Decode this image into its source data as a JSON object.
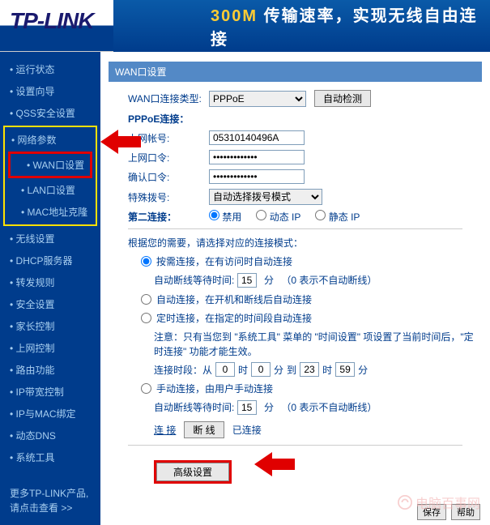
{
  "header": {
    "logo": "TP-LINK",
    "banner_prefix": "300M",
    "banner_text": " 传输速率，实现无线自由连接"
  },
  "sidebar": {
    "items": [
      {
        "label": "运行状态"
      },
      {
        "label": "设置向导"
      },
      {
        "label": "QSS安全设置"
      },
      {
        "label": "网络参数"
      },
      {
        "label": "WAN口设置",
        "sub": true,
        "current": true
      },
      {
        "label": "LAN口设置",
        "sub": true
      },
      {
        "label": "MAC地址克隆",
        "sub": true
      },
      {
        "label": "无线设置"
      },
      {
        "label": "DHCP服务器"
      },
      {
        "label": "转发规则"
      },
      {
        "label": "安全设置"
      },
      {
        "label": "家长控制"
      },
      {
        "label": "上网控制"
      },
      {
        "label": "路由功能"
      },
      {
        "label": "IP带宽控制"
      },
      {
        "label": "IP与MAC绑定"
      },
      {
        "label": "动态DNS"
      },
      {
        "label": "系统工具"
      }
    ],
    "more_l1": "更多TP-LINK产品,",
    "more_l2": "请点击查看 >>"
  },
  "panel": {
    "title": "WAN口设置",
    "conn_type_label": "WAN口连接类型:",
    "conn_type_value": "PPPoE",
    "auto_detect": "自动检测",
    "pppoe_label": "PPPoE连接：",
    "account_label": "上网帐号:",
    "account_value": "05310140496A",
    "password_label": "上网口令:",
    "password_value": "•••••••••••••",
    "confirm_label": "确认口令:",
    "confirm_value": "•••••••••••••",
    "special_label": "特殊拨号:",
    "special_value": "自动选择拨号模式",
    "second_conn_label": "第二连接：",
    "second_opts": [
      "禁用",
      "动态 IP",
      "静态 IP"
    ],
    "need_note": "根据您的需要，请选择对应的连接模式：",
    "mode1": "按需连接，在有访问时自动连接",
    "wait_label": "自动断线等待时间:",
    "wait_value": "15",
    "wait_unit": "分",
    "wait_hint": "（0 表示不自动断线）",
    "mode2": "自动连接，在开机和断线后自动连接",
    "mode3": "定时连接，在指定的时间段自动连接",
    "mode3_note": "注意：只有当您到 \"系统工具\" 菜单的 \"时间设置\" 项设置了当前时间后，\"定时连接\" 功能才能生效。",
    "time_label": "连接时段：从",
    "t1": "0",
    "t2": "0",
    "to": "到",
    "t3": "23",
    "t4": "59",
    "hour": "时",
    "minute": "分",
    "mode4": "手动连接，由用户手动连接",
    "wait2_value": "15",
    "connect": "连 接",
    "disconnect": "断 线",
    "status": "已连接",
    "advanced": "高级设置",
    "save": "保存",
    "help": "帮助"
  },
  "watermark": "电脑百事网"
}
